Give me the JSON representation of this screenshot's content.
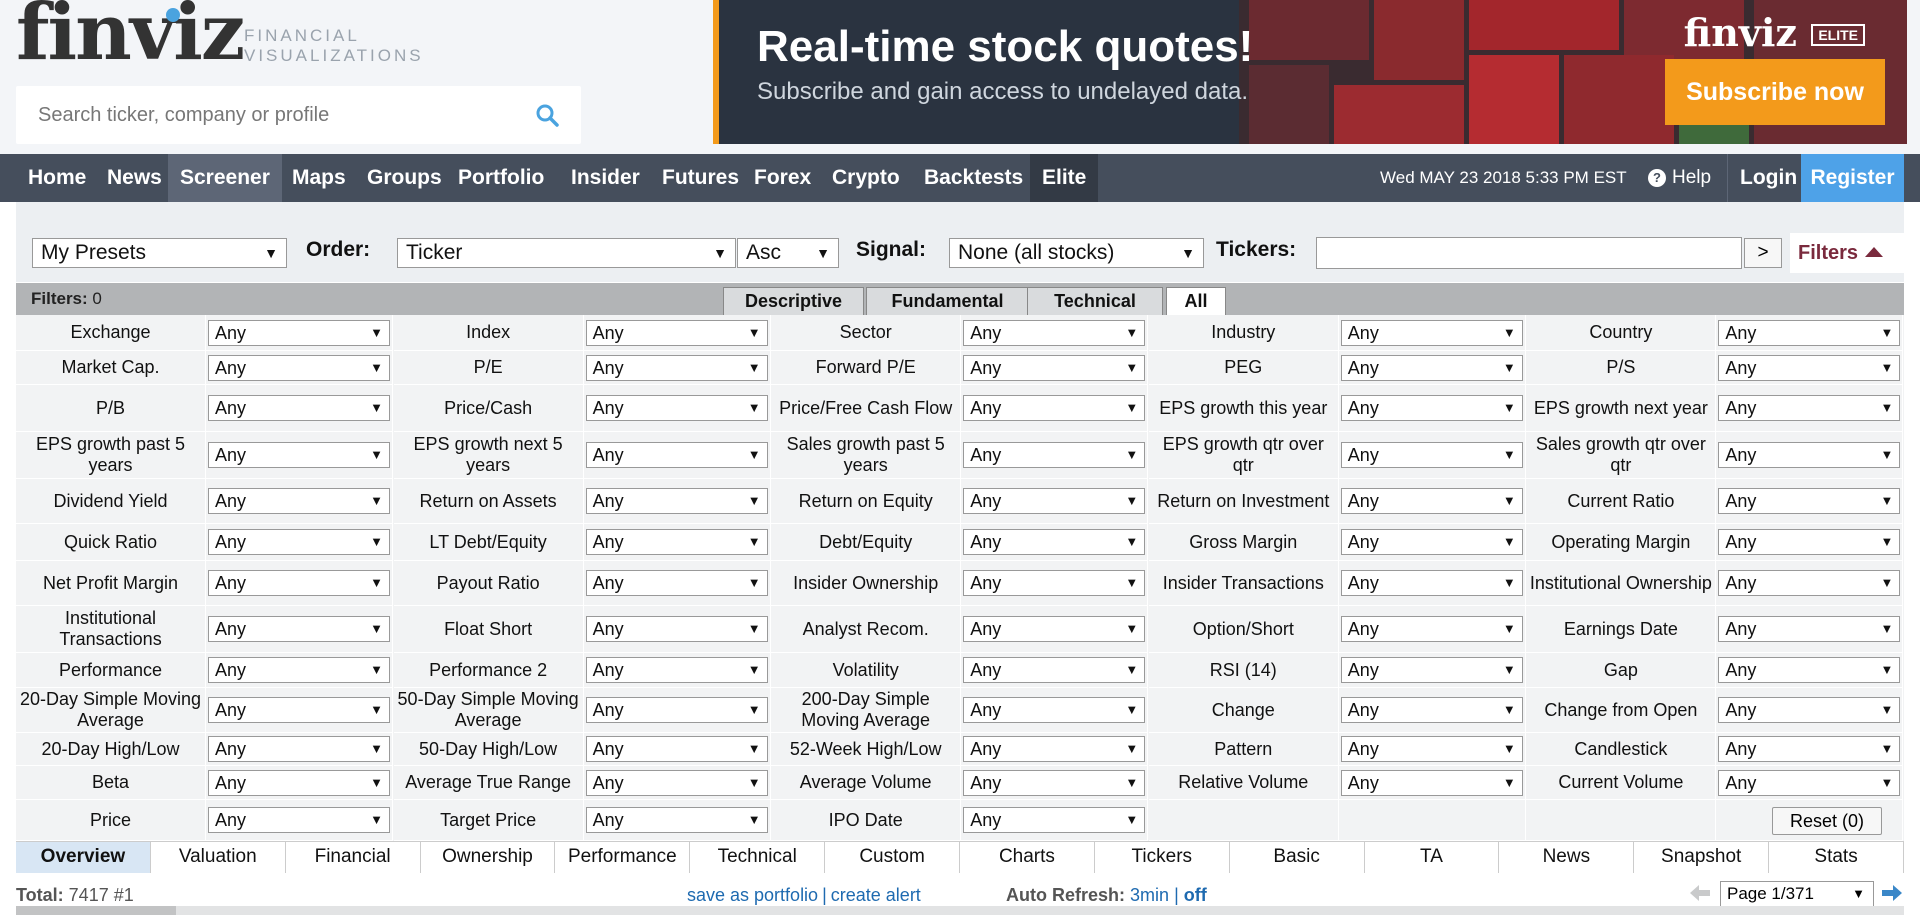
{
  "logo": {
    "word": "finviz",
    "tagline_1": "FINANCIAL",
    "tagline_2": "VISUALIZATIONS"
  },
  "search": {
    "placeholder": "Search ticker, company or profile"
  },
  "banner": {
    "title": "Real-time stock quotes!",
    "subtitle": "Subscribe and gain access to undelayed data.",
    "brand": "finviz",
    "elite_badge": "ELITE",
    "button": "Subscribe now"
  },
  "nav": {
    "items": [
      "Home",
      "News",
      "Screener",
      "Maps",
      "Groups",
      "Portfolio",
      "Insider",
      "Futures",
      "Forex",
      "Crypto",
      "Backtests",
      "Elite"
    ],
    "active": "Screener",
    "datetime": "Wed MAY 23 2018 5:33 PM EST",
    "help": "Help",
    "login": "Login",
    "register": "Register"
  },
  "controls": {
    "presets": "My Presets",
    "order_label": "Order:",
    "order_value": "Ticker",
    "direction": "Asc",
    "signal_label": "Signal:",
    "signal_value": "None (all stocks)",
    "tickers_label": "Tickers:",
    "tickers_value": "",
    "go": ">",
    "filters_toggle": "Filters"
  },
  "filter_header": {
    "label": "Filters:",
    "count": "0",
    "tabs": [
      "Descriptive",
      "Fundamental",
      "Technical",
      "All"
    ],
    "active_tab": "All"
  },
  "filters": [
    [
      "Exchange",
      "Index",
      "Sector",
      "Industry",
      "Country"
    ],
    [
      "Market Cap.",
      "P/E",
      "Forward P/E",
      "PEG",
      "P/S"
    ],
    [
      "P/B",
      "Price/Cash",
      "Price/Free Cash Flow",
      "EPS growth this year",
      "EPS growth next year"
    ],
    [
      "EPS growth past 5 years",
      "EPS growth next 5 years",
      "Sales growth past 5 years",
      "EPS growth qtr over qtr",
      "Sales growth qtr over qtr"
    ],
    [
      "Dividend Yield",
      "Return on Assets",
      "Return on Equity",
      "Return on Investment",
      "Current Ratio"
    ],
    [
      "Quick Ratio",
      "LT Debt/Equity",
      "Debt/Equity",
      "Gross Margin",
      "Operating Margin"
    ],
    [
      "Net Profit Margin",
      "Payout Ratio",
      "Insider Ownership",
      "Insider Transactions",
      "Institutional Ownership"
    ],
    [
      "Institutional Transactions",
      "Float Short",
      "Analyst Recom.",
      "Option/Short",
      "Earnings Date"
    ],
    [
      "Performance",
      "Performance 2",
      "Volatility",
      "RSI (14)",
      "Gap"
    ],
    [
      "20-Day Simple Moving Average",
      "50-Day Simple Moving Average",
      "200-Day Simple Moving Average",
      "Change",
      "Change from Open"
    ],
    [
      "20-Day High/Low",
      "50-Day High/Low",
      "52-Week High/Low",
      "Pattern",
      "Candlestick"
    ],
    [
      "Beta",
      "Average True Range",
      "Average Volume",
      "Relative Volume",
      "Current Volume"
    ],
    [
      "Price",
      "Target Price",
      "IPO Date"
    ]
  ],
  "filter_value": "Any",
  "reset": "Reset (0)",
  "view_tabs": [
    "Overview",
    "Valuation",
    "Financial",
    "Ownership",
    "Performance",
    "Technical",
    "Custom",
    "Charts",
    "Tickers",
    "Basic",
    "TA",
    "News",
    "Snapshot",
    "Stats"
  ],
  "active_view": "Overview",
  "footer": {
    "total_label": "Total:",
    "total_value": "7417 #1",
    "save_portfolio": "save as portfolio",
    "create_alert": "create alert",
    "auto_refresh_label": "Auto Refresh:",
    "refresh_interval": "3min",
    "refresh_off": "off",
    "page": "Page 1/371"
  },
  "colors": {
    "nav_bg": "#454e5c",
    "register": "#4ea2e8",
    "banner_accent": "#f39a1b",
    "link": "#1e6ab0",
    "filters_toggle": "#7a2a3d"
  }
}
